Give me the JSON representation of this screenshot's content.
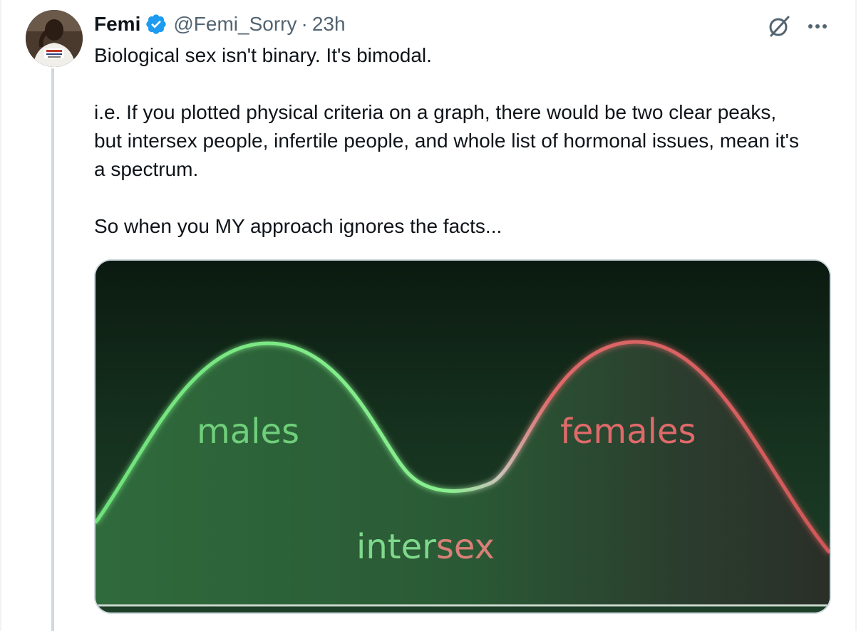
{
  "tweet": {
    "author_name": "Femi",
    "handle": "@Femi_Sorry",
    "separator": "·",
    "time": "23h",
    "paragraphs": [
      "Biological sex isn't binary. It's bimodal.",
      "i.e. If you plotted physical criteria on a graph, there would be two clear peaks, but intersex people, infertile people, and whole list of hormonal issues, mean it's a spectrum.",
      "So when you MY approach ignores the facts..."
    ]
  },
  "icons": {
    "verified": "verified-badge-icon",
    "grok": "grok-icon",
    "more": "more-options-icon"
  },
  "colors": {
    "verified_blue": "#1d9bf0",
    "text_primary": "#0f1419",
    "text_secondary": "#536471",
    "thread_line": "#cfd9de",
    "curve_green": "#6fe27a",
    "curve_red": "#e06a6a"
  },
  "media": {
    "label_left": "males",
    "label_right": "females",
    "label_center_a": "inter",
    "label_center_b": "sex"
  }
}
